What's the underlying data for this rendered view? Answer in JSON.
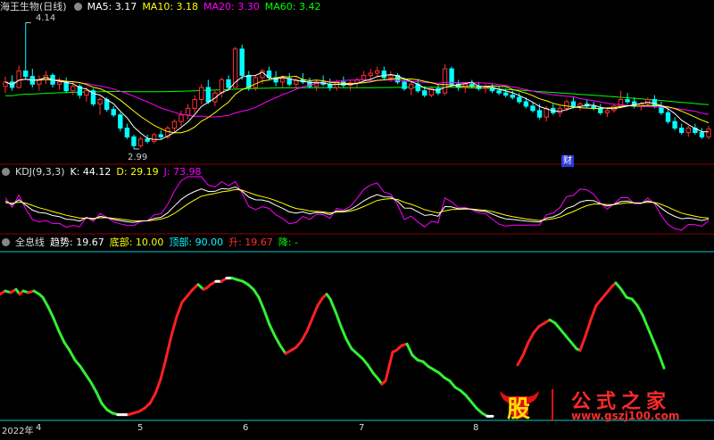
{
  "panels": {
    "main": {
      "title": "海王生物(日线)",
      "indicators": [
        {
          "label": "MA5: 3.17",
          "color": "#ffffff"
        },
        {
          "label": "MA10: 3.18",
          "color": "#ffff00"
        },
        {
          "label": "MA20: 3.30",
          "color": "#ff00ff"
        },
        {
          "label": "MA60: 3.42",
          "color": "#00ff00"
        }
      ],
      "high_label": "4.14",
      "low_label": "2.99",
      "finance_marker": "财"
    },
    "kdj": {
      "title": "KDJ(9,3,3)",
      "indicators": [
        {
          "label": "K: 44.12",
          "color": "#ffffff"
        },
        {
          "label": "D: 29.19",
          "color": "#ffff00"
        },
        {
          "label": "J: 73.98",
          "color": "#ff00ff"
        }
      ]
    },
    "hologram": {
      "title": "全息线",
      "indicators": [
        {
          "label": "趋势: 19.67",
          "color": "#ffffff"
        },
        {
          "label": "底部: 10.00",
          "color": "#ffff00"
        },
        {
          "label": "顶部: 90.00",
          "color": "#00ffff"
        },
        {
          "label": "升: 19.67",
          "color": "#ff3030"
        },
        {
          "label": "降: -",
          "color": "#00ff00"
        }
      ]
    }
  },
  "x_axis": {
    "labels": [
      "2022年",
      "4",
      "5",
      "6",
      "7",
      "8"
    ]
  },
  "watermark": {
    "logo_glyph": "股",
    "brand": "公式之家",
    "url": "www.gszj100.com"
  },
  "colors": {
    "up": "#ff3232",
    "down": "#00ffff",
    "ma5": "#ffffff",
    "ma10": "#ffff00",
    "ma20": "#ff00ff",
    "ma60": "#00ff00",
    "trend_up": "#ff2020",
    "trend_down": "#33ee33",
    "trend_flat": "#ffffff",
    "divider": "#8b0000"
  },
  "chart_data": [
    {
      "type": "candlestick",
      "title": "海王生物(日线)",
      "series": [
        {
          "name": "MA5",
          "value": 3.17
        },
        {
          "name": "MA10",
          "value": 3.18
        },
        {
          "name": "MA20",
          "value": 3.3
        },
        {
          "name": "MA60",
          "value": 3.42
        }
      ],
      "ylim": [
        2.9,
        4.2
      ],
      "annotations": [
        {
          "label": "4.14",
          "kind": "period high"
        },
        {
          "label": "2.99",
          "kind": "period low"
        }
      ],
      "candles": [
        [
          3.56,
          3.65,
          3.5,
          3.6
        ],
        [
          3.6,
          3.66,
          3.52,
          3.55
        ],
        [
          3.55,
          3.75,
          3.54,
          3.7
        ],
        [
          3.7,
          4.14,
          3.62,
          3.65
        ],
        [
          3.65,
          3.72,
          3.55,
          3.58
        ],
        [
          3.58,
          3.66,
          3.52,
          3.62
        ],
        [
          3.62,
          3.7,
          3.58,
          3.66
        ],
        [
          3.66,
          3.68,
          3.55,
          3.58
        ],
        [
          3.58,
          3.64,
          3.53,
          3.6
        ],
        [
          3.6,
          3.64,
          3.5,
          3.52
        ],
        [
          3.52,
          3.6,
          3.48,
          3.56
        ],
        [
          3.56,
          3.58,
          3.45,
          3.48
        ],
        [
          3.48,
          3.55,
          3.42,
          3.52
        ],
        [
          3.52,
          3.54,
          3.38,
          3.4
        ],
        [
          3.4,
          3.46,
          3.3,
          3.44
        ],
        [
          3.44,
          3.46,
          3.33,
          3.35
        ],
        [
          3.35,
          3.38,
          3.28,
          3.3
        ],
        [
          3.3,
          3.32,
          3.15,
          3.18
        ],
        [
          3.18,
          3.22,
          3.08,
          3.1
        ],
        [
          3.1,
          3.12,
          2.99,
          3.02
        ],
        [
          3.02,
          3.1,
          3.0,
          3.08
        ],
        [
          3.08,
          3.12,
          3.04,
          3.06
        ],
        [
          3.06,
          3.14,
          3.04,
          3.12
        ],
        [
          3.12,
          3.16,
          3.08,
          3.1
        ],
        [
          3.1,
          3.2,
          3.08,
          3.18
        ],
        [
          3.18,
          3.26,
          3.14,
          3.24
        ],
        [
          3.24,
          3.34,
          3.2,
          3.3
        ],
        [
          3.3,
          3.4,
          3.26,
          3.36
        ],
        [
          3.36,
          3.48,
          3.32,
          3.44
        ],
        [
          3.44,
          3.58,
          3.4,
          3.55
        ],
        [
          3.55,
          3.62,
          3.4,
          3.42
        ],
        [
          3.42,
          3.52,
          3.38,
          3.5
        ],
        [
          3.5,
          3.64,
          3.46,
          3.62
        ],
        [
          3.62,
          3.66,
          3.52,
          3.55
        ],
        [
          3.55,
          3.92,
          3.55,
          3.9
        ],
        [
          3.9,
          3.94,
          3.62,
          3.66
        ],
        [
          3.66,
          3.7,
          3.52,
          3.55
        ],
        [
          3.55,
          3.66,
          3.52,
          3.64
        ],
        [
          3.64,
          3.72,
          3.58,
          3.7
        ],
        [
          3.7,
          3.74,
          3.62,
          3.64
        ],
        [
          3.64,
          3.7,
          3.56,
          3.6
        ],
        [
          3.6,
          3.66,
          3.55,
          3.63
        ],
        [
          3.63,
          3.68,
          3.56,
          3.58
        ],
        [
          3.58,
          3.64,
          3.54,
          3.62
        ],
        [
          3.62,
          3.68,
          3.58,
          3.6
        ],
        [
          3.6,
          3.64,
          3.54,
          3.56
        ],
        [
          3.56,
          3.62,
          3.52,
          3.6
        ],
        [
          3.6,
          3.66,
          3.56,
          3.58
        ],
        [
          3.58,
          3.63,
          3.52,
          3.55
        ],
        [
          3.55,
          3.62,
          3.52,
          3.6
        ],
        [
          3.6,
          3.65,
          3.55,
          3.57
        ],
        [
          3.57,
          3.62,
          3.52,
          3.59
        ],
        [
          3.59,
          3.64,
          3.55,
          3.62
        ],
        [
          3.62,
          3.7,
          3.6,
          3.66
        ],
        [
          3.66,
          3.72,
          3.62,
          3.68
        ],
        [
          3.68,
          3.74,
          3.64,
          3.7
        ],
        [
          3.7,
          3.74,
          3.62,
          3.64
        ],
        [
          3.64,
          3.7,
          3.6,
          3.66
        ],
        [
          3.66,
          3.68,
          3.58,
          3.6
        ],
        [
          3.6,
          3.64,
          3.52,
          3.54
        ],
        [
          3.54,
          3.6,
          3.48,
          3.58
        ],
        [
          3.58,
          3.62,
          3.5,
          3.52
        ],
        [
          3.52,
          3.56,
          3.46,
          3.48
        ],
        [
          3.48,
          3.56,
          3.46,
          3.54
        ],
        [
          3.54,
          3.58,
          3.48,
          3.5
        ],
        [
          3.5,
          3.76,
          3.48,
          3.72
        ],
        [
          3.72,
          3.74,
          3.56,
          3.58
        ],
        [
          3.58,
          3.62,
          3.52,
          3.55
        ],
        [
          3.55,
          3.6,
          3.5,
          3.58
        ],
        [
          3.58,
          3.62,
          3.54,
          3.56
        ],
        [
          3.56,
          3.6,
          3.52,
          3.54
        ],
        [
          3.54,
          3.58,
          3.5,
          3.55
        ],
        [
          3.55,
          3.58,
          3.5,
          3.52
        ],
        [
          3.52,
          3.56,
          3.48,
          3.5
        ],
        [
          3.5,
          3.54,
          3.46,
          3.48
        ],
        [
          3.48,
          3.52,
          3.44,
          3.46
        ],
        [
          3.46,
          3.5,
          3.4,
          3.42
        ],
        [
          3.42,
          3.46,
          3.36,
          3.38
        ],
        [
          3.38,
          3.42,
          3.32,
          3.34
        ],
        [
          3.34,
          3.4,
          3.26,
          3.28
        ],
        [
          3.28,
          3.38,
          3.24,
          3.36
        ],
        [
          3.36,
          3.4,
          3.3,
          3.32
        ],
        [
          3.32,
          3.38,
          3.28,
          3.36
        ],
        [
          3.36,
          3.44,
          3.34,
          3.42
        ],
        [
          3.42,
          3.46,
          3.36,
          3.38
        ],
        [
          3.38,
          3.42,
          3.34,
          3.4
        ],
        [
          3.4,
          3.44,
          3.36,
          3.38
        ],
        [
          3.38,
          3.42,
          3.34,
          3.36
        ],
        [
          3.36,
          3.4,
          3.3,
          3.32
        ],
        [
          3.32,
          3.36,
          3.28,
          3.34
        ],
        [
          3.34,
          3.4,
          3.32,
          3.38
        ],
        [
          3.38,
          3.52,
          3.36,
          3.44
        ],
        [
          3.44,
          3.5,
          3.4,
          3.42
        ],
        [
          3.42,
          3.46,
          3.36,
          3.38
        ],
        [
          3.38,
          3.42,
          3.34,
          3.4
        ],
        [
          3.4,
          3.46,
          3.38,
          3.44
        ],
        [
          3.44,
          3.48,
          3.36,
          3.38
        ],
        [
          3.38,
          3.42,
          3.3,
          3.32
        ],
        [
          3.32,
          3.36,
          3.22,
          3.24
        ],
        [
          3.24,
          3.28,
          3.16,
          3.18
        ],
        [
          3.18,
          3.22,
          3.12,
          3.14
        ],
        [
          3.14,
          3.2,
          3.1,
          3.18
        ],
        [
          3.18,
          3.22,
          3.12,
          3.14
        ],
        [
          3.14,
          3.18,
          3.08,
          3.1
        ],
        [
          3.1,
          3.2,
          3.08,
          3.17
        ]
      ]
    },
    {
      "type": "line",
      "title": "KDJ(9,3,3)",
      "series": [
        {
          "name": "K",
          "last": 44.12
        },
        {
          "name": "D",
          "last": 29.19
        },
        {
          "name": "J",
          "last": 73.98
        }
      ],
      "ylim": [
        -10,
        110
      ]
    },
    {
      "type": "line",
      "title": "全息线",
      "series": [
        {
          "name": "趋势",
          "last": 19.67
        },
        {
          "name": "底部",
          "value": 10.0
        },
        {
          "name": "顶部",
          "value": 90.0
        },
        {
          "name": "升",
          "last": 19.67
        }
      ],
      "ylim": [
        0,
        100
      ],
      "trend_points": [
        [
          0,
          78
        ],
        [
          6,
          80
        ],
        [
          12,
          79
        ],
        [
          18,
          81
        ],
        [
          22,
          78
        ],
        [
          26,
          80
        ],
        [
          32,
          79
        ],
        [
          38,
          80
        ],
        [
          44,
          78
        ],
        [
          48,
          76
        ],
        [
          54,
          70
        ],
        [
          60,
          63
        ],
        [
          66,
          55
        ],
        [
          72,
          48
        ],
        [
          78,
          43
        ],
        [
          84,
          37
        ],
        [
          90,
          33
        ],
        [
          96,
          28
        ],
        [
          102,
          23
        ],
        [
          108,
          17
        ],
        [
          114,
          10
        ],
        [
          120,
          6
        ],
        [
          126,
          4
        ],
        [
          132,
          3
        ],
        [
          138,
          3
        ],
        [
          144,
          3
        ],
        [
          150,
          4
        ],
        [
          156,
          5
        ],
        [
          162,
          7
        ],
        [
          168,
          10
        ],
        [
          174,
          16
        ],
        [
          180,
          25
        ],
        [
          186,
          38
        ],
        [
          192,
          52
        ],
        [
          198,
          64
        ],
        [
          204,
          73
        ],
        [
          210,
          77
        ],
        [
          216,
          81
        ],
        [
          222,
          84
        ],
        [
          228,
          81
        ],
        [
          232,
          82
        ],
        [
          236,
          84
        ],
        [
          242,
          86
        ],
        [
          248,
          86
        ],
        [
          254,
          88
        ],
        [
          260,
          88
        ],
        [
          266,
          87
        ],
        [
          272,
          86
        ],
        [
          278,
          84
        ],
        [
          284,
          81
        ],
        [
          290,
          76
        ],
        [
          296,
          68
        ],
        [
          302,
          59
        ],
        [
          308,
          52
        ],
        [
          314,
          46
        ],
        [
          320,
          41
        ],
        [
          326,
          43
        ],
        [
          332,
          45
        ],
        [
          338,
          49
        ],
        [
          344,
          55
        ],
        [
          350,
          63
        ],
        [
          356,
          71
        ],
        [
          362,
          76
        ],
        [
          366,
          78
        ],
        [
          370,
          75
        ],
        [
          376,
          67
        ],
        [
          382,
          58
        ],
        [
          388,
          50
        ],
        [
          394,
          44
        ],
        [
          400,
          41
        ],
        [
          406,
          38
        ],
        [
          412,
          34
        ],
        [
          418,
          29
        ],
        [
          424,
          25
        ],
        [
          428,
          22
        ],
        [
          432,
          24
        ],
        [
          436,
          33
        ],
        [
          440,
          42
        ],
        [
          444,
          43
        ],
        [
          450,
          46
        ],
        [
          456,
          47
        ],
        [
          462,
          40
        ],
        [
          468,
          37
        ],
        [
          474,
          36
        ],
        [
          480,
          33
        ],
        [
          486,
          31
        ],
        [
          492,
          29
        ],
        [
          498,
          26
        ],
        [
          504,
          24
        ],
        [
          510,
          20
        ],
        [
          516,
          18
        ],
        [
          522,
          15
        ],
        [
          528,
          11
        ],
        [
          534,
          7
        ],
        [
          540,
          4
        ],
        [
          546,
          2
        ],
        [
          552,
          2
        ]
      ],
      "trend_points_2": [
        [
          580,
          34
        ],
        [
          586,
          40
        ],
        [
          592,
          48
        ],
        [
          598,
          54
        ],
        [
          604,
          58
        ],
        [
          610,
          60
        ],
        [
          616,
          62
        ],
        [
          622,
          60
        ],
        [
          628,
          56
        ],
        [
          634,
          52
        ],
        [
          640,
          48
        ],
        [
          646,
          44
        ],
        [
          650,
          43
        ],
        [
          656,
          52
        ],
        [
          662,
          62
        ],
        [
          668,
          71
        ],
        [
          674,
          75
        ],
        [
          680,
          79
        ],
        [
          686,
          83
        ],
        [
          690,
          85
        ],
        [
          696,
          81
        ],
        [
          702,
          76
        ],
        [
          708,
          75
        ],
        [
          714,
          71
        ],
        [
          720,
          65
        ],
        [
          726,
          57
        ],
        [
          732,
          49
        ],
        [
          738,
          41
        ],
        [
          744,
          32
        ]
      ]
    }
  ]
}
